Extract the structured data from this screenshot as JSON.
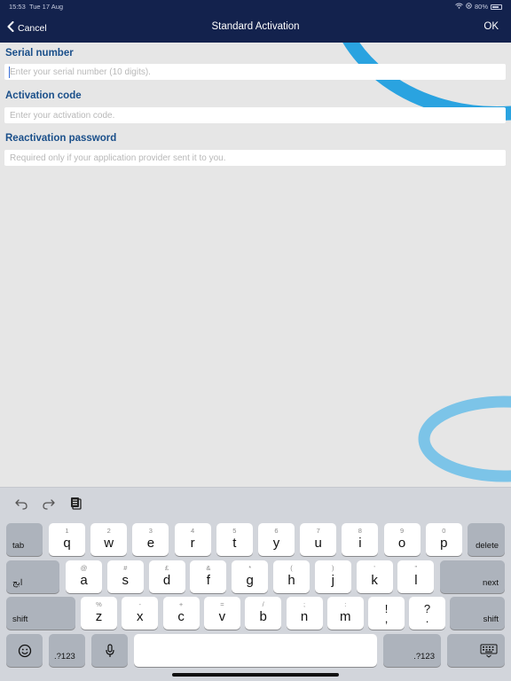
{
  "status": {
    "time": "15:53",
    "date": "Tue 17 Aug",
    "battery": "80%",
    "battery_level": 0.8
  },
  "nav": {
    "cancel_label": "Cancel",
    "title": "Standard Activation",
    "ok_label": "OK"
  },
  "form": {
    "serial": {
      "label": "Serial number",
      "placeholder": "Enter your serial number (10 digits).",
      "value": ""
    },
    "activation": {
      "label": "Activation code",
      "placeholder": "Enter your activation code.",
      "value": ""
    },
    "reactivation": {
      "label": "Reactivation password",
      "placeholder": "Required only if your application provider sent it to you.",
      "value": ""
    }
  },
  "colors": {
    "nav_bg": "#13224d",
    "label_blue": "#1a4f8a",
    "deco_blue": "#2aa3e0"
  },
  "keyboard": {
    "toolbar": [
      "undo-icon",
      "redo-icon",
      "clipboard-icon"
    ],
    "row1": {
      "tab": "tab",
      "keys": [
        {
          "main": "q",
          "sub": "1"
        },
        {
          "main": "w",
          "sub": "2"
        },
        {
          "main": "e",
          "sub": "3"
        },
        {
          "main": "r",
          "sub": "4"
        },
        {
          "main": "t",
          "sub": "5"
        },
        {
          "main": "y",
          "sub": "6"
        },
        {
          "main": "u",
          "sub": "7"
        },
        {
          "main": "i",
          "sub": "8"
        },
        {
          "main": "o",
          "sub": "9"
        },
        {
          "main": "p",
          "sub": "0"
        }
      ],
      "delete": "delete"
    },
    "row2": {
      "lang": "ابج",
      "keys": [
        {
          "main": "a",
          "sub": "@"
        },
        {
          "main": "s",
          "sub": "#"
        },
        {
          "main": "d",
          "sub": "£"
        },
        {
          "main": "f",
          "sub": "&"
        },
        {
          "main": "g",
          "sub": "*"
        },
        {
          "main": "h",
          "sub": "("
        },
        {
          "main": "j",
          "sub": ")"
        },
        {
          "main": "k",
          "sub": "'"
        },
        {
          "main": "l",
          "sub": "\""
        }
      ],
      "next": "next"
    },
    "row3": {
      "shift": "shift",
      "keys": [
        {
          "main": "z",
          "sub": "%"
        },
        {
          "main": "x",
          "sub": "-"
        },
        {
          "main": "c",
          "sub": "+"
        },
        {
          "main": "v",
          "sub": "="
        },
        {
          "main": "b",
          "sub": "/"
        },
        {
          "main": "n",
          "sub": ";"
        },
        {
          "main": "m",
          "sub": ":"
        }
      ],
      "punct": [
        {
          "top": "!",
          "bot": ","
        },
        {
          "top": "?",
          "bot": "."
        }
      ],
      "shift_right": "shift"
    },
    "row4": {
      "numbers_left": ".?123",
      "numbers_right": ".?123"
    }
  }
}
